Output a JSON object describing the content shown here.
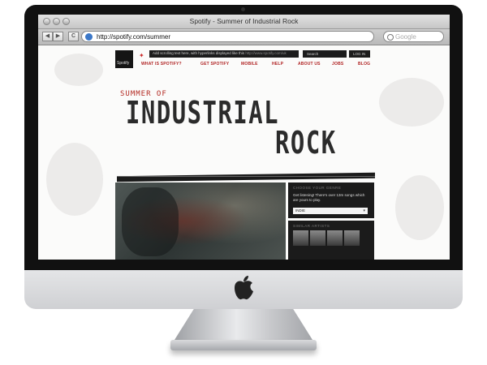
{
  "browser": {
    "window_title": "Spotify - Summer of Industrial Rock",
    "url": "http://spotify.com/summer",
    "search_placeholder": "Google",
    "back_glyph": "◀",
    "forward_glyph": "▶",
    "reload_glyph": "C"
  },
  "site": {
    "logo_text": "Spotify",
    "ticker_text": "Add scrolling text here, with hyperlinks displayed like this",
    "ticker_link": "http://www.spotify.com/uk",
    "search_label": "Search",
    "login_label": "LOG IN",
    "nav": [
      "WHAT IS SPOTIFY?",
      "GET SPOTIFY",
      "MOBILE",
      "HELP",
      "ABOUT US",
      "JOBS",
      "BLOG"
    ]
  },
  "hero": {
    "subtitle": "SUMMER OF",
    "title_line1": "INDUSTRIAL",
    "title_line2": "ROCK"
  },
  "genre": {
    "heading": "CHOOSE YOUR GENRE",
    "description": "Get listening! There's over 13m songs which are yours to play.",
    "selected": "INDIE"
  },
  "artists": {
    "heading": "SIMILAR ARTISTS"
  },
  "colors": {
    "accent": "#b02222",
    "dark": "#1b1b1b"
  },
  "icons": [
    "apple-logo-icon",
    "twitter-bird-icon",
    "globe-icon",
    "magnifier-icon"
  ]
}
